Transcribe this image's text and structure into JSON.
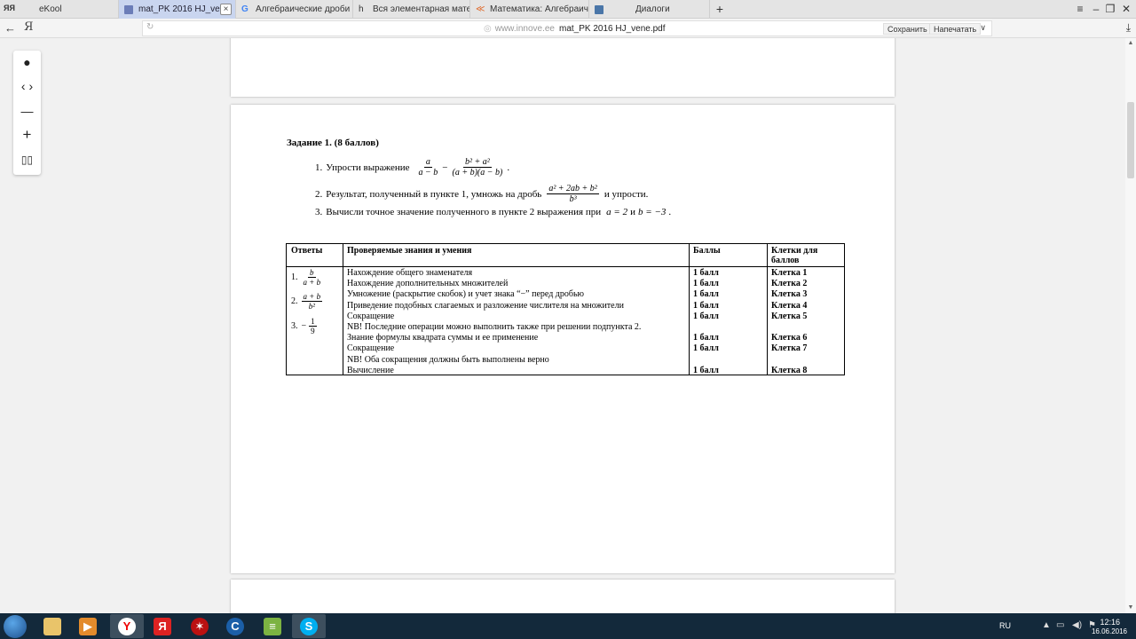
{
  "browser": {
    "tabs": [
      {
        "label": "eKool",
        "icon": "ekool-icon"
      },
      {
        "label": "mat_PK 2016 HJ_vene.pdf",
        "icon": "pdf-icon",
        "active": true
      },
      {
        "label": "Алгебраические дроби - П",
        "icon": "google-icon"
      },
      {
        "label": "Вся элементарная матема",
        "icon": "site-icon"
      },
      {
        "label": "Математика: Алгебраическ",
        "icon": "math-site-icon"
      },
      {
        "label": "Диалоги",
        "icon": "dialogs-icon"
      }
    ],
    "new_tab": "+",
    "brand": "Я",
    "url_domain": "www.innove.ee",
    "url_file": "mat_PK 2016 HJ_vene.pdf",
    "save_label": "Сохранить",
    "print_label": "Напечатать"
  },
  "viewer": {
    "tools": [
      "pointer",
      "page-nav",
      "zoom-out",
      "zoom-in",
      "fit-page"
    ]
  },
  "task": {
    "title": "Задание 1. (8 баллов)",
    "item1_num": "1.",
    "item1_text": "Упрости выражение",
    "item1_frac1_num": "a",
    "item1_frac1_den": "a − b",
    "item1_minus": "−",
    "item1_frac2_num": "b² + a²",
    "item1_frac2_den": "(a + b)(a − b)",
    "item1_end": ".",
    "item2_num": "2.",
    "item2_text": "Результат, полученный в пункте 1, умножь на дробь",
    "item2_frac_num": "a² + 2ab + b²",
    "item2_frac_den": "b³",
    "item2_end": "и упрости.",
    "item3_num": "3.",
    "item3_text": "Вычисли точное значение полученного в пункте 2 выражения при",
    "item3_math1": "a = 2",
    "item3_and": "и",
    "item3_math2": "b = −3",
    "item3_end": "."
  },
  "table": {
    "headers": {
      "answers": "Ответы",
      "skills": "Проверяемые знания и умения",
      "points": "Баллы",
      "cells": "Клетки для баллов"
    },
    "answers": [
      {
        "num": "1.",
        "frac_num": "b",
        "frac_den": "a + b"
      },
      {
        "num": "2.",
        "frac_num": "a + b",
        "frac_den": "b²"
      },
      {
        "num": "3.",
        "sign": "−",
        "frac_num": "1",
        "frac_den": "9"
      }
    ],
    "rows": [
      {
        "skill": "Нахождение общего знаменателя",
        "points": "1 балл",
        "cell": "Клетка 1"
      },
      {
        "skill": "Нахождение дополнительных множителей",
        "points": "1 балл",
        "cell": "Клетка 2"
      },
      {
        "skill": "Умножение (раскрытие скобок) и учет знака “−” перед дробью",
        "points": "1 балл",
        "cell": "Клетка 3"
      },
      {
        "skill": "Приведение подобных слагаемых и разложение числителя на множители",
        "points": "1 балл",
        "cell": "Клетка 4"
      },
      {
        "skill": "Сокращение",
        "points": "1 балл",
        "cell": "Клетка 5"
      },
      {
        "skill": "NB! Последние операции можно выполнить также при решении подпункта 2.",
        "points": "",
        "cell": ""
      },
      {
        "skill": "Знание формулы квадрата суммы и ее применение",
        "points": "1 балл",
        "cell": "Клетка 6"
      },
      {
        "skill": "Сокращение",
        "points": "1 балл",
        "cell": "Клетка 7"
      },
      {
        "skill": "NB! Оба сокращения должны быть выполнены верно",
        "points": "",
        "cell": ""
      },
      {
        "skill": "Вычисление",
        "points": "1 балл",
        "cell": "Клетка 8"
      }
    ]
  },
  "taskbar": {
    "apps": [
      "file-explorer",
      "media-player",
      "yandex-browser",
      "yandex",
      "game-app",
      "ccleaner",
      "stack-app",
      "skype"
    ],
    "lang": "RU",
    "time": "12:16",
    "date": "16.06.2016"
  }
}
